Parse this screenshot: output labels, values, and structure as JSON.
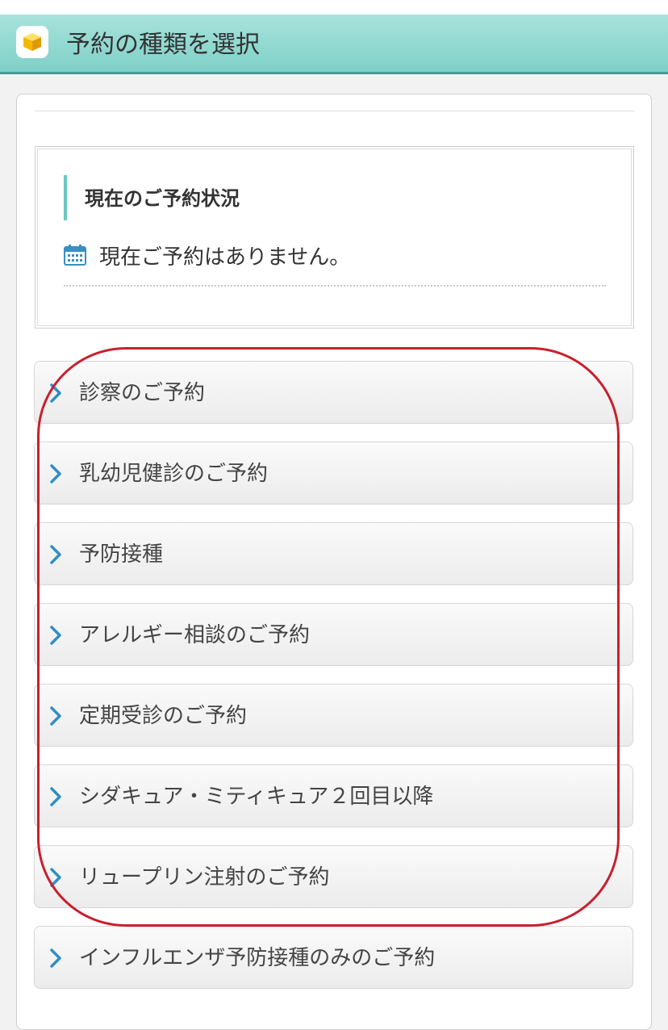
{
  "header": {
    "title": "予約の種類を選択",
    "app_icon": "yellow-cube-icon",
    "color": "#7fd0c7"
  },
  "status": {
    "heading": "現在のご予約状況",
    "icon": "calendar-icon",
    "text": "現在ご予約はありません。"
  },
  "menu": {
    "items": [
      {
        "label": "診察のご予約"
      },
      {
        "label": "乳幼児健診のご予約"
      },
      {
        "label": "予防接種"
      },
      {
        "label": "アレルギー相談のご予約"
      },
      {
        "label": "定期受診のご予約"
      },
      {
        "label": "シダキュア・ミティキュア２回目以降"
      },
      {
        "label": "リュープリン注射のご予約"
      },
      {
        "label": "インフルエンザ予防接種のみのご予約"
      }
    ],
    "chevron_icon": "chevron-right-icon",
    "accent": "#2f8fc6"
  },
  "annotation": {
    "color": "#c8202e"
  }
}
